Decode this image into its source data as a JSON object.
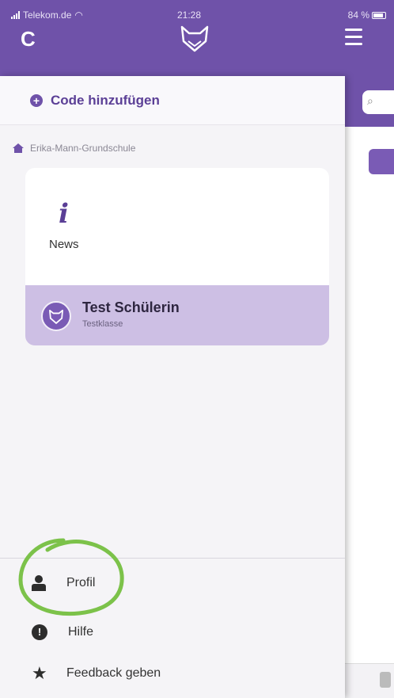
{
  "status_bar": {
    "carrier": "Telekom.de",
    "time": "21:28",
    "battery": "84 %"
  },
  "header": {
    "reload_icon": "reload-icon",
    "logo_icon": "fox-logo-icon",
    "menu_icon": "hamburger-menu-icon"
  },
  "drawer": {
    "add_code_label": "Code hinzufügen",
    "school_name": "Erika-Mann-Grundschule",
    "news_label": "News",
    "student": {
      "name": "Test Schülerin",
      "class": "Testklasse"
    },
    "menu": [
      {
        "label": "Profil",
        "icon": "person-icon"
      },
      {
        "label": "Hilfe",
        "icon": "help-icon"
      },
      {
        "label": "Feedback geben",
        "icon": "star-icon"
      }
    ]
  },
  "colors": {
    "brand_purple": "#6f52a9",
    "selected_card": "#cdbfe4",
    "annotation_green": "#7cc24a"
  }
}
